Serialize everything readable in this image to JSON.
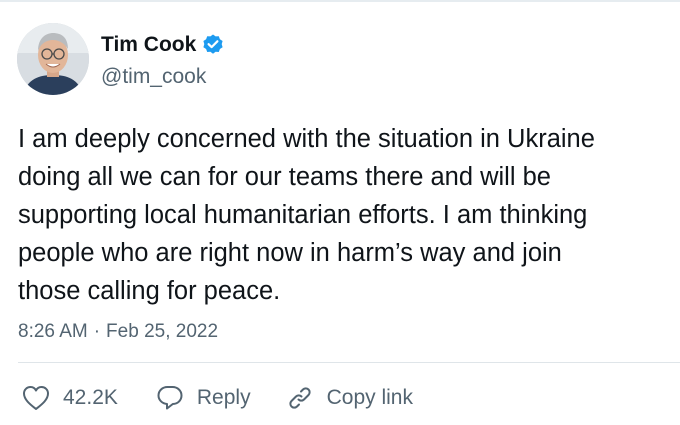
{
  "author": {
    "display_name": "Tim Cook",
    "handle": "@tim_cook",
    "verified": true,
    "avatar_icon": "profile-photo"
  },
  "tweet": {
    "lines": [
      "I am deeply concerned with the situation in Ukraine",
      "doing all we can for our teams there and will be",
      "supporting local humanitarian efforts. I am thinking",
      "people who are right now in harm’s way and join",
      "those calling for peace."
    ],
    "time": "8:26 AM",
    "separator": "·",
    "date": "Feb 25, 2022"
  },
  "actions": {
    "like_count": "42.2K",
    "reply_label": "Reply",
    "copy_link_label": "Copy link"
  },
  "colors": {
    "verified_blue": "#1d9bf0",
    "secondary_text": "#536471",
    "primary_text": "#0f1419"
  }
}
